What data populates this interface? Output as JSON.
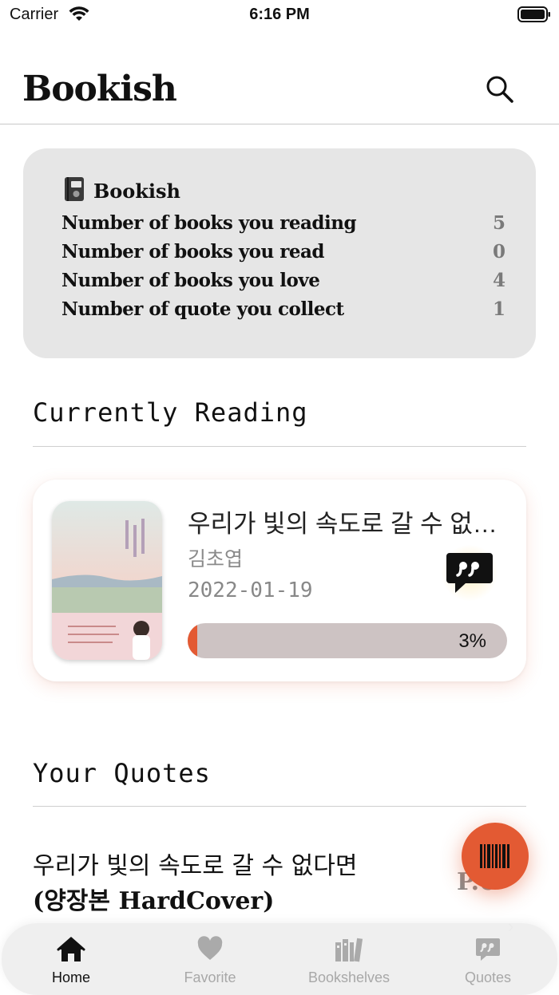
{
  "status_bar": {
    "carrier": "Carrier",
    "time": "6:16 PM"
  },
  "header": {
    "title": "Bookish",
    "search_icon": "search-icon"
  },
  "stats": {
    "brand_label": "Bookish",
    "brand_icon": "notebook-icon",
    "rows": [
      {
        "label": "Number of books you reading",
        "value": "5"
      },
      {
        "label": "Number of books you read",
        "value": "0"
      },
      {
        "label": "Number of books you love",
        "value": "4"
      },
      {
        "label": "Number of quote you collect",
        "value": "1"
      }
    ]
  },
  "currently_reading": {
    "section_title": "Currently Reading",
    "book": {
      "title": "우리가 빛의 속도로 갈 수 없다면",
      "author": "김초엽",
      "date": "2022-01-19",
      "progress_text": "3%",
      "progress_fraction": 0.03,
      "quote_icon": "speech-bubble-quote-icon"
    }
  },
  "your_quotes": {
    "section_title": "Your Quotes",
    "items": [
      {
        "book_title_line1": "우리가 빛의 속도로 갈 수 없다면",
        "book_title_line2": "(양장본 HardCover)",
        "page_prefix": "P.6"
      }
    ]
  },
  "fab": {
    "icon": "barcode-icon"
  },
  "tab_bar": {
    "tabs": [
      {
        "label": "Home",
        "icon": "home-icon",
        "active": true
      },
      {
        "label": "Favorite",
        "icon": "heart-icon",
        "active": false
      },
      {
        "label": "Bookshelves",
        "icon": "bookshelf-icon",
        "active": false
      },
      {
        "label": "Quotes",
        "icon": "quote-bubble-icon",
        "active": false
      }
    ]
  },
  "colors": {
    "accent": "#e35a33",
    "card_bg": "#e6e6e6",
    "progress_track": "#cdc3c3"
  }
}
